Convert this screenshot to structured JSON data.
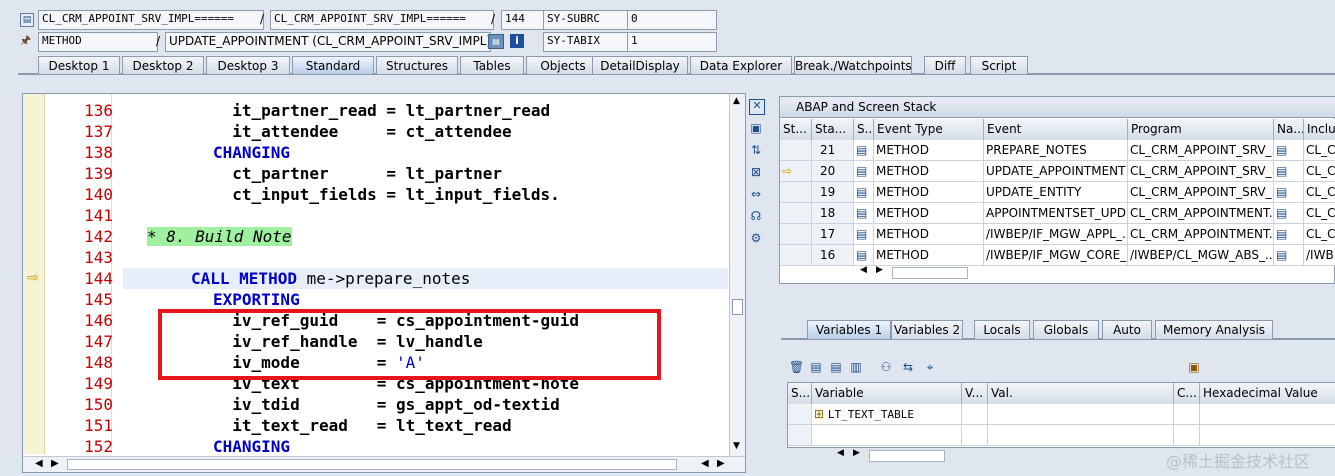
{
  "header": {
    "row1": {
      "program": "CL_CRM_APPOINT_SRV_IMPL======",
      "include": "CL_CRM_APPOINT_SRV_IMPL======",
      "line": "144",
      "sysvar_name": "SY-SUBRC",
      "sysvar_value": "0"
    },
    "row2": {
      "kind": "METHOD",
      "name": "UPDATE_APPOINTMENT (CL_CRM_APPOINT_SRV_IMPL)",
      "sysvar_name": "SY-TABIX",
      "sysvar_value": "1"
    },
    "slash": "/"
  },
  "tabs": [
    "Desktop 1",
    "Desktop 2",
    "Desktop 3",
    "Standard",
    "Structures",
    "Tables",
    "Objects",
    "DetailDisplay",
    "Data Explorer",
    "Break./Watchpoints",
    "Diff",
    "Script"
  ],
  "active_tab": "Standard",
  "code": [
    {
      "n": "136",
      "t": "  it_partner_read = lt_partner_read"
    },
    {
      "n": "137",
      "t": "  it_attendee     = ct_attendee"
    },
    {
      "n": "138",
      "kw": "CHANGING"
    },
    {
      "n": "139",
      "t": "  ct_partner      = lt_partner"
    },
    {
      "n": "140",
      "t": "  ct_input_fields = lt_input_fields."
    },
    {
      "n": "141",
      "t": ""
    },
    {
      "n": "142",
      "comment": "* 8. Build Note"
    },
    {
      "n": "143",
      "t": ""
    },
    {
      "n": "144",
      "call": "CALL METHOD",
      "rest": " me->prepare_notes"
    },
    {
      "n": "145",
      "kw": "EXPORTING"
    },
    {
      "n": "146",
      "t": "  iv_ref_guid    = cs_appointment-guid"
    },
    {
      "n": "147",
      "t": "  iv_ref_handle  = lv_handle"
    },
    {
      "n": "148",
      "t": "  iv_mode        = ",
      "s": "'A'"
    },
    {
      "n": "149",
      "t": "  iv_text        = cs_appointment-note"
    },
    {
      "n": "150",
      "t": "  iv_tdid        = gs_appt_od-textid"
    },
    {
      "n": "151",
      "t": "  it_text_read   = lt_text_read"
    },
    {
      "n": "152",
      "kw": "CHANGING"
    }
  ],
  "stack": {
    "title": "ABAP and Screen Stack",
    "headers": [
      "St...",
      "Sta...",
      "S...",
      "Event Type",
      "Event",
      "Program",
      "Na...",
      "Inclu"
    ],
    "rows": [
      {
        "level": "21",
        "type": "METHOD",
        "event": "PREPARE_NOTES",
        "program": "CL_CRM_APPOINT_SRV_...",
        "incl": "CL_CI"
      },
      {
        "level": "20",
        "type": "METHOD",
        "event": "UPDATE_APPOINTMENT",
        "program": "CL_CRM_APPOINT_SRV_...",
        "incl": "CL_CI",
        "current": true
      },
      {
        "level": "19",
        "type": "METHOD",
        "event": "UPDATE_ENTITY",
        "program": "CL_CRM_APPOINT_SRV_...",
        "incl": "CL_CI"
      },
      {
        "level": "18",
        "type": "METHOD",
        "event": "APPOINTMENTSET_UPD...",
        "program": "CL_CRM_APPOINTMENT...",
        "incl": "CL_CI"
      },
      {
        "level": "17",
        "type": "METHOD",
        "event": "/IWBEP/IF_MGW_APPL_...",
        "program": "CL_CRM_APPOINTMENT...",
        "incl": "CL_CI"
      },
      {
        "level": "16",
        "type": "METHOD",
        "event": "/IWBEP/IF_MGW_CORE_...",
        "program": "/IWBEP/CL_MGW_ABS_...",
        "incl": "/IWB"
      }
    ]
  },
  "var_tabs": [
    "Variables 1",
    "Variables 2",
    "Locals",
    "Globals",
    "Auto",
    "Memory Analysis"
  ],
  "active_var_tab": "Variables 1",
  "variables": {
    "headers": [
      "S...",
      "Variable",
      "V...",
      "Val.",
      "C...",
      "Hexadecimal Value"
    ],
    "rows": [
      {
        "name": "LT_TEXT_TABLE"
      }
    ]
  },
  "watermark": "@稀土掘金技术社区",
  "colors": {
    "highlight_box": "#e8141b",
    "keyword": "#0000c8",
    "line_number": "#c40000",
    "comment_bg": "#9ff09f"
  }
}
